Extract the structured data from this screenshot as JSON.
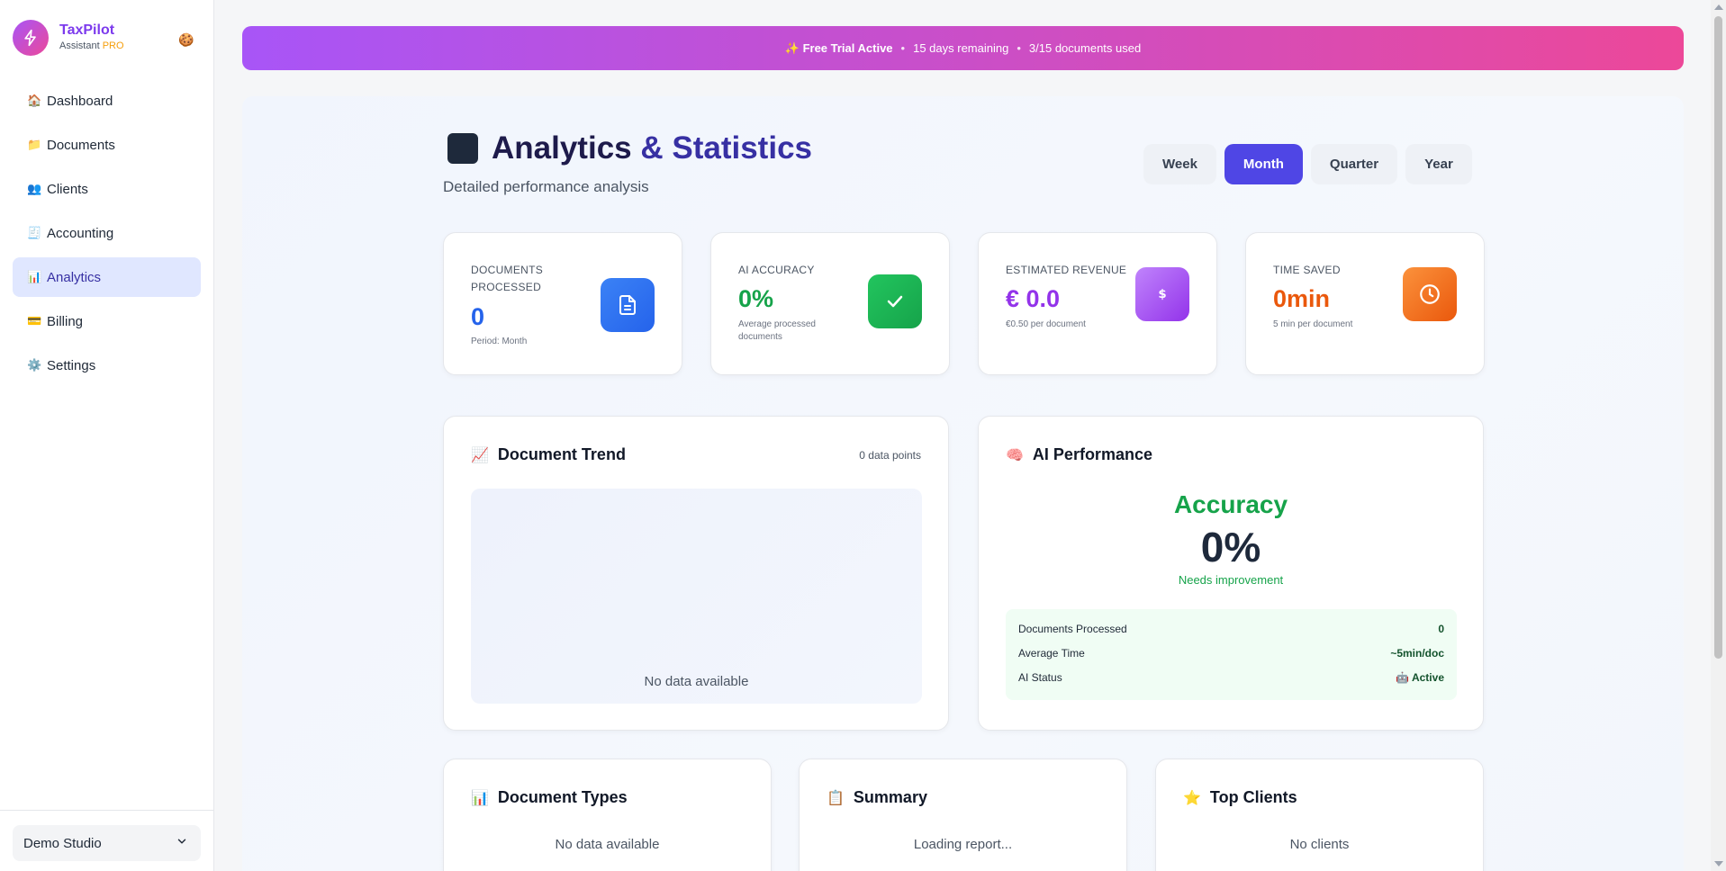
{
  "brand": {
    "name": "TaxPilot",
    "sub": "Assistant",
    "badge": "PRO",
    "emoji": "🍪"
  },
  "nav": {
    "items": [
      {
        "icon": "🏠",
        "label": "Dashboard"
      },
      {
        "icon": "📁",
        "label": "Documents"
      },
      {
        "icon": "👥",
        "label": "Clients"
      },
      {
        "icon": "🧾",
        "label": "Accounting"
      },
      {
        "icon": "📊",
        "label": "Analytics"
      },
      {
        "icon": "💳",
        "label": "Billing"
      },
      {
        "icon": "⚙️",
        "label": "Settings"
      }
    ],
    "active": "Analytics"
  },
  "studio": {
    "label": "Demo Studio"
  },
  "trial": {
    "sparkle": "✨",
    "title": "Free Trial Active",
    "remaining": "15 days remaining",
    "usage": "3/15 documents used",
    "sep": "•"
  },
  "page": {
    "title_a": "Analytics",
    "title_amp": "&",
    "title_b": "Statistics",
    "subtitle": "Detailed performance analysis"
  },
  "periods": {
    "week": "Week",
    "month": "Month",
    "quarter": "Quarter",
    "year": "Year",
    "active": "Month"
  },
  "stats": {
    "docs": {
      "label": "Documents Processed",
      "value": "0",
      "note": "Period: Month"
    },
    "accuracy": {
      "label": "AI Accuracy",
      "value": "0%",
      "note": "Average processed documents"
    },
    "revenue": {
      "label": "Estimated Revenue",
      "value": "€ 0.0",
      "note": "€0.50 per document"
    },
    "time": {
      "label": "Time Saved",
      "value": "0min",
      "note": "5 min per document"
    }
  },
  "trend": {
    "icon": "📈",
    "title": "Document Trend",
    "points": "0 data points",
    "empty": "No data available"
  },
  "ai_perf": {
    "icon": "🧠",
    "title": "AI Performance",
    "heading": "Accuracy",
    "value": "0%",
    "status": "Needs improvement",
    "rows": [
      {
        "label": "Documents Processed",
        "value": "0"
      },
      {
        "label": "Average Time",
        "value": "~5min/doc"
      },
      {
        "label": "AI Status",
        "icon": "🤖",
        "value": "Active"
      }
    ]
  },
  "doc_types": {
    "icon": "📊",
    "title": "Document Types",
    "empty": "No data available"
  },
  "summary": {
    "icon": "📋",
    "title": "Summary",
    "loading": "Loading report..."
  },
  "top_clients": {
    "icon": "⭐",
    "title": "Top Clients",
    "empty": "No clients"
  },
  "colors": {
    "accent": "#4f46e5",
    "brand_purple": "#a855f7",
    "brand_pink": "#ec4899",
    "blue": "#2563eb",
    "green": "#16a34a",
    "purple": "#9333ea",
    "orange": "#ea580c"
  }
}
